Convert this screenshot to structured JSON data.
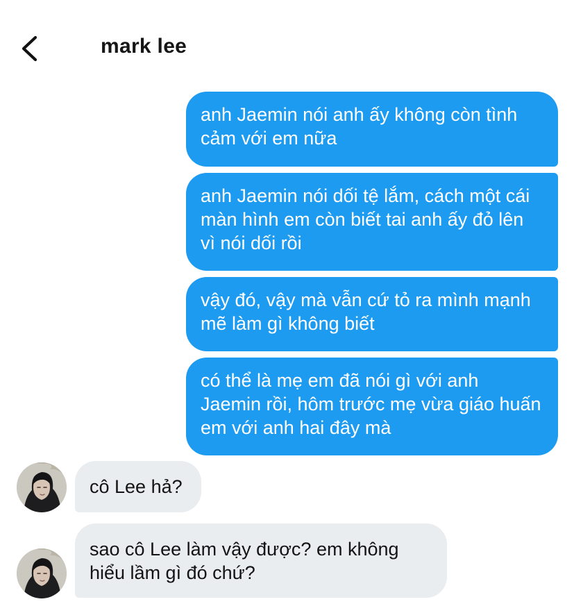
{
  "header": {
    "back_icon": "chevron-left-icon",
    "contact_name": "mark lee"
  },
  "messages": [
    {
      "direction": "outgoing",
      "text": "anh Jaemin nói anh ấy không còn tình cảm với em nữa"
    },
    {
      "direction": "outgoing",
      "text": "anh Jaemin nói dối tệ lắm, cách một cái màn hình em còn biết tai anh ấy đỏ lên vì nói dối rồi"
    },
    {
      "direction": "outgoing",
      "text": "vậy đó, vậy mà vẫn cứ tỏ ra mình mạnh mẽ làm gì không biết"
    },
    {
      "direction": "outgoing",
      "text": "có thể là mẹ em đã nói gì với anh Jaemin rồi, hôm trước mẹ vừa giáo huấn em với anh hai đây mà"
    },
    {
      "direction": "incoming",
      "text": "cô Lee hả?"
    },
    {
      "direction": "incoming",
      "text": "sao cô Lee làm vậy được? em không hiểu lầm gì đó chứ?"
    }
  ],
  "colors": {
    "outgoing_bubble": "#1d9bf0",
    "incoming_bubble": "#eaedf0",
    "text_dark": "#141414",
    "text_light": "#ffffff"
  }
}
